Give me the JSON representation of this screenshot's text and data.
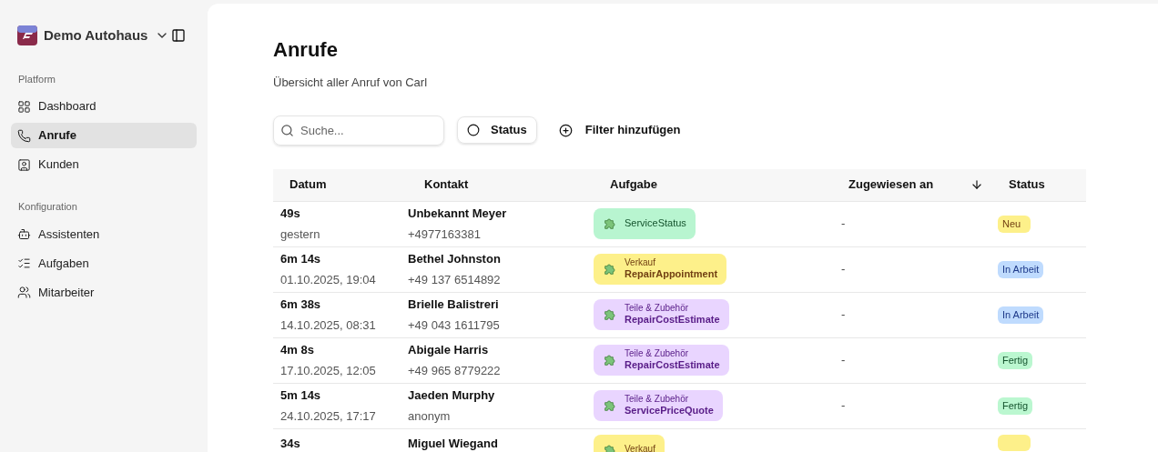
{
  "workspace": {
    "name": "Demo Autohaus"
  },
  "sidebar": {
    "groups": [
      {
        "label": "Platform",
        "items": [
          {
            "label": "Dashboard",
            "selected": false
          },
          {
            "label": "Anrufe",
            "selected": true
          },
          {
            "label": "Kunden",
            "selected": false
          }
        ]
      },
      {
        "label": "Konfiguration",
        "items": [
          {
            "label": "Assistenten",
            "selected": false
          },
          {
            "label": "Aufgaben",
            "selected": false
          },
          {
            "label": "Mitarbeiter",
            "selected": false
          }
        ]
      }
    ]
  },
  "page": {
    "title": "Anrufe",
    "subtitle": "Übersicht aller Anruf von Carl"
  },
  "toolbar": {
    "search": {
      "placeholder": "Suche..."
    },
    "status_filter": "Status",
    "add_filter": "Filter hinzufügen"
  },
  "table": {
    "columns": [
      {
        "label": "Datum"
      },
      {
        "label": "Kontakt"
      },
      {
        "label": "Aufgabe"
      },
      {
        "label": "Zugewiesen an",
        "sorted": true
      },
      {
        "label": "Status"
      }
    ],
    "rows": [
      {
        "duration": "49s",
        "date": "gestern",
        "name": "Unbekannt Meyer",
        "phone": "+4977163381",
        "task": {
          "kind": "service",
          "name": "ServiceStatus"
        },
        "assigned": "-",
        "status": {
          "kind": "new",
          "label": "Neu"
        }
      },
      {
        "duration": "6m 14s",
        "date": "01.10.2025, 19:04",
        "name": "Bethel Johnston",
        "phone": "+49 137 6514892",
        "task": {
          "kind": "sales",
          "category": "Verkauf",
          "name": "RepairAppointment"
        },
        "assigned": "-",
        "status": {
          "kind": "progress",
          "label": "In Arbeit"
        }
      },
      {
        "duration": "6m 38s",
        "date": "14.10.2025, 08:31",
        "name": "Brielle Balistreri",
        "phone": "+49 043 1611795",
        "task": {
          "kind": "parts",
          "category": "Teile & Zubehör",
          "name": "RepairCostEstimate"
        },
        "assigned": "-",
        "status": {
          "kind": "progress",
          "label": "In Arbeit"
        }
      },
      {
        "duration": "4m 8s",
        "date": "17.10.2025, 12:05",
        "name": "Abigale Harris",
        "phone": "+49 965 8779222",
        "task": {
          "kind": "parts",
          "category": "Teile & Zubehör",
          "name": "RepairCostEstimate"
        },
        "assigned": "-",
        "status": {
          "kind": "done",
          "label": "Fertig"
        }
      },
      {
        "duration": "5m 14s",
        "date": "24.10.2025, 17:17",
        "name": "Jaeden Murphy",
        "phone": "anonym",
        "task": {
          "kind": "parts",
          "category": "Teile & Zubehör",
          "name": "ServicePriceQuote"
        },
        "assigned": "-",
        "status": {
          "kind": "done",
          "label": "Fertig"
        }
      },
      {
        "duration": "34s",
        "name": "Miguel Wiegand",
        "task": {
          "kind": "sales",
          "category": "Verkauf"
        },
        "status": {
          "kind": "new"
        }
      }
    ]
  }
}
